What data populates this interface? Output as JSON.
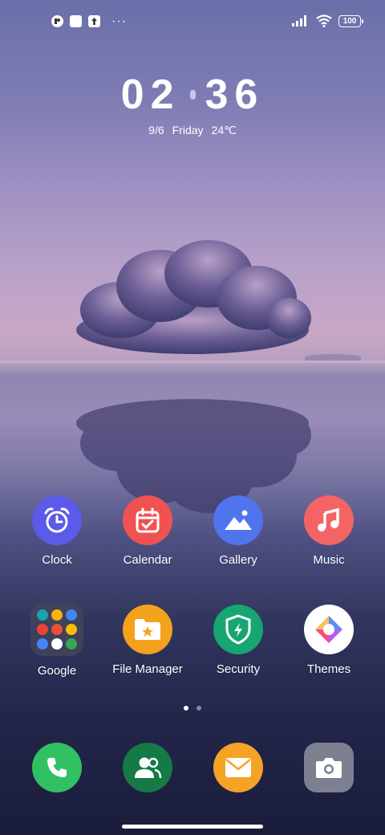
{
  "status_bar": {
    "left_icons": [
      "notification-app-icon",
      "notification-square-icon",
      "upload-icon"
    ],
    "more": "···",
    "battery": "100",
    "right_icons": [
      "signal-icon",
      "wifi-icon",
      "battery-icon"
    ]
  },
  "lock": {
    "hour": "02",
    "minute": "36",
    "date": "9/6",
    "weekday": "Friday",
    "temperature": "24℃"
  },
  "apps_row1": [
    {
      "label": "Clock",
      "icon": "alarm-clock-icon",
      "color": "#5c5ae8"
    },
    {
      "label": "Calendar",
      "icon": "calendar-check-icon",
      "color": "#f05252"
    },
    {
      "label": "Gallery",
      "icon": "mountain-image-icon",
      "color": "#4f74ee"
    },
    {
      "label": "Music",
      "icon": "music-note-icon",
      "color": "#f46464"
    }
  ],
  "apps_row2": [
    {
      "label": "Google",
      "icon": "google-folder-icon"
    },
    {
      "label": "File Manager",
      "icon": "folder-star-icon",
      "color": "#f4a11c"
    },
    {
      "label": "Security",
      "icon": "shield-bolt-icon",
      "color": "#17a672"
    },
    {
      "label": "Themes",
      "icon": "themes-icon",
      "color": "#ffffff"
    }
  ],
  "dock": [
    {
      "name": "phone",
      "icon": "phone-icon",
      "color": "#31c163"
    },
    {
      "name": "contacts",
      "icon": "contacts-icon",
      "color": "#157a45"
    },
    {
      "name": "email",
      "icon": "envelope-icon",
      "color": "#f5a326"
    },
    {
      "name": "camera",
      "icon": "camera-icon",
      "color": "#7c8090"
    }
  ],
  "pages": {
    "count": 2,
    "active": 1
  }
}
